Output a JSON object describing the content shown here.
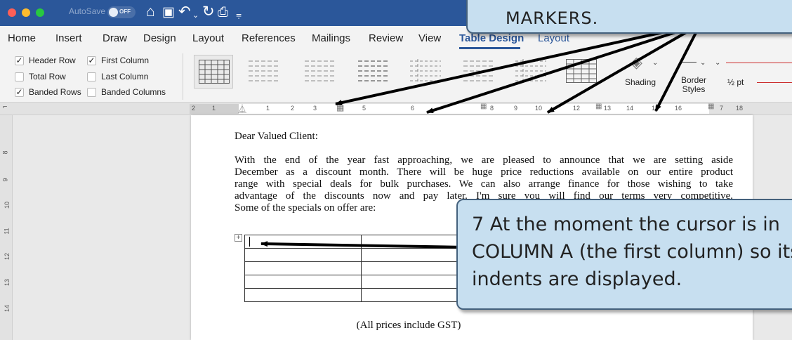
{
  "titlebar": {
    "autosave_label": "AutoSave",
    "autosave_state": "OFF"
  },
  "tabs": [
    {
      "label": "Home"
    },
    {
      "label": "Insert"
    },
    {
      "label": "Draw"
    },
    {
      "label": "Design"
    },
    {
      "label": "Layout"
    },
    {
      "label": "References"
    },
    {
      "label": "Mailings"
    },
    {
      "label": "Review"
    },
    {
      "label": "View"
    },
    {
      "label": "Table Design",
      "active": true
    },
    {
      "label": "Layout",
      "accent": true
    }
  ],
  "ribbon": {
    "options": {
      "header_row": "Header Row",
      "first_column": "First Column",
      "total_row": "Total Row",
      "last_column": "Last Column",
      "banded_rows": "Banded Rows",
      "banded_columns": "Banded Columns"
    },
    "shading_label": "Shading",
    "border_styles_label": "Border Styles",
    "pen_weight": "½ pt"
  },
  "ruler": {
    "numbers": [
      "2",
      "1",
      "1",
      "2",
      "3",
      "5",
      "6",
      "8",
      "9",
      "10",
      "12",
      "13",
      "14",
      "15",
      "16",
      "7",
      "18"
    ]
  },
  "vruler": {
    "numbers": [
      "8",
      "9",
      "10",
      "11",
      "12",
      "13",
      "14"
    ]
  },
  "document": {
    "greeting": "Dear Valued Client:",
    "paragraph_lines": [
      "With the end of the year fast approaching, we are pleased to announce that we are setting aside",
      "December as a discount month.  There will be huge price reductions available on our entire product",
      "range with special deals for bulk purchases.  We can also arrange finance for those wishing to take",
      "advantage of the discounts now and pay later.  I'm sure you will find our terms very competitive.",
      "Some of the specials on offer are:"
    ],
    "footer_note": "(All prices include GST)"
  },
  "callouts": {
    "top_text": "MARKERS.",
    "main_line1": "7  At the moment the cursor is in",
    "main_line2": "COLUMN A (the first column) so its",
    "main_line3": "indents are displayed."
  }
}
